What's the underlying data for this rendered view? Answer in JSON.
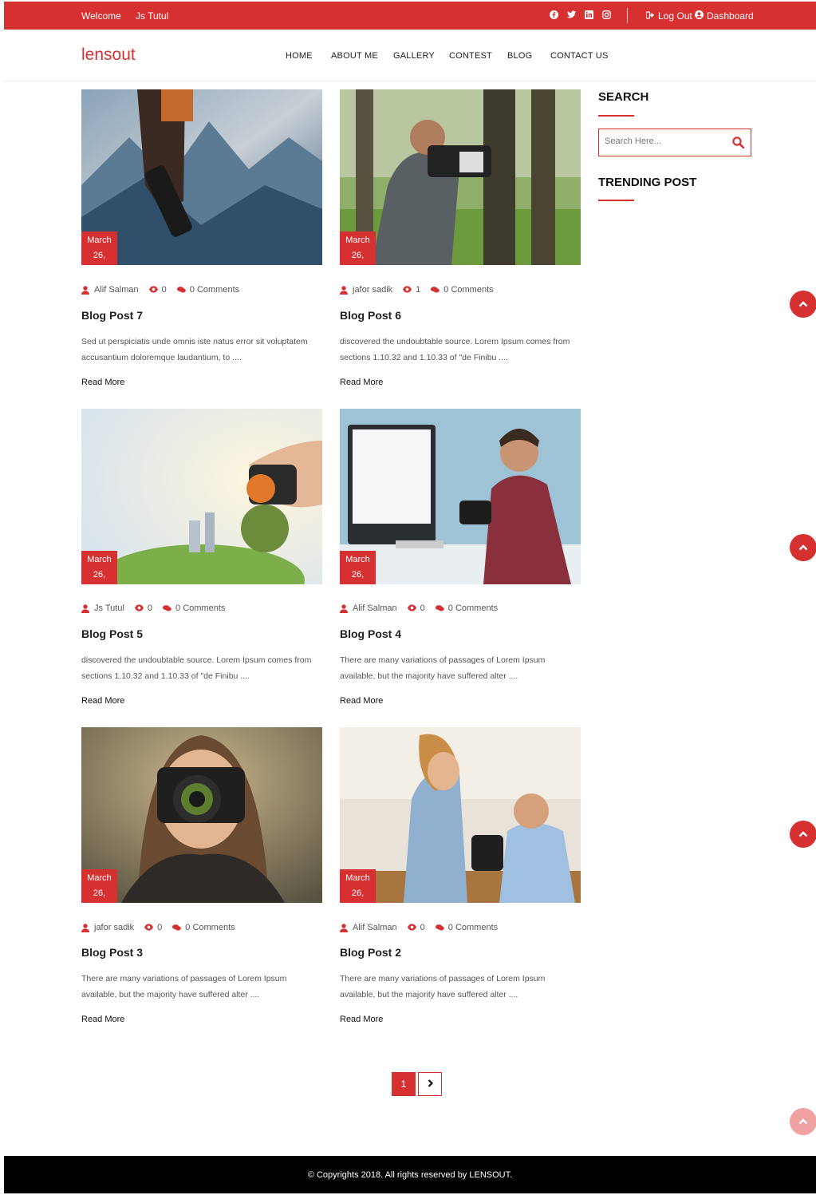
{
  "topbar": {
    "welcome": "Welcome",
    "user": "Js Tutul",
    "socials": [
      "facebook-icon",
      "twitter-icon",
      "linkedin-icon",
      "instagram-icon"
    ],
    "logout": "Log Out",
    "dashboard": "Dashboard"
  },
  "header": {
    "logo": "lensout",
    "nav": [
      "HOME",
      "ABOUT ME",
      "GALLERY",
      "CONTEST",
      "BLOG",
      "CONTACT US"
    ]
  },
  "posts": [
    {
      "month": "March",
      "day": "26,",
      "author": "Alif Salman",
      "views": "0",
      "comments": "0 Comments",
      "title": "Blog Post 7",
      "excerpt1": "Sed ut perspiciatis unde omnis iste natus error sit voluptatem",
      "excerpt2": "accusantium doloremque laudantium, to ....",
      "read_more": "Read More"
    },
    {
      "month": "March",
      "day": "26,",
      "author": "jafor sadik",
      "views": "1",
      "comments": "0 Comments",
      "title": "Blog Post 6",
      "excerpt1": "discovered the undoubtable source. Lorem Ipsum comes from",
      "excerpt2": "sections 1.10.32 and 1.10.33 of \"de Finibu ....",
      "read_more": "Read More"
    },
    {
      "month": "March",
      "day": "26,",
      "author": "Js Tutul",
      "views": "0",
      "comments": "0 Comments",
      "title": "Blog Post 5",
      "excerpt1": "discovered the undoubtable source. Lorem Ipsum comes from",
      "excerpt2": "sections 1.10.32 and 1.10.33 of \"de Finibu ....",
      "read_more": "Read More"
    },
    {
      "month": "March",
      "day": "26,",
      "author": "Alif Salman",
      "views": "0",
      "comments": "0 Comments",
      "title": "Blog Post 4",
      "excerpt1": "There are many variations of passages of Lorem Ipsum",
      "excerpt2": "available, but the majority have suffered alter ....",
      "read_more": "Read More"
    },
    {
      "month": "March",
      "day": "26,",
      "author": "jafor sadik",
      "views": "0",
      "comments": "0 Comments",
      "title": "Blog Post 3",
      "excerpt1": "There are many variations of passages of Lorem Ipsum",
      "excerpt2": "available, but the majority have suffered alter ....",
      "read_more": "Read More"
    },
    {
      "month": "March",
      "day": "26,",
      "author": "Alif Salman",
      "views": "0",
      "comments": "0 Comments",
      "title": "Blog Post 2",
      "excerpt1": "There are many variations of passages of Lorem Ipsum",
      "excerpt2": "available, but the majority have suffered alter ....",
      "read_more": "Read More"
    }
  ],
  "sidebar": {
    "search_title": "SEARCH",
    "search_placeholder": "Search Here...",
    "trending_title": "TRENDING POST"
  },
  "pagination": {
    "current": "1",
    "next_icon": "chevron-right-icon"
  },
  "footer": {
    "copyright": "© Copyrights 2018. All rights reserved by LENSOUT."
  },
  "colors": {
    "accent": "#d63031",
    "footer_bg": "#000000"
  }
}
